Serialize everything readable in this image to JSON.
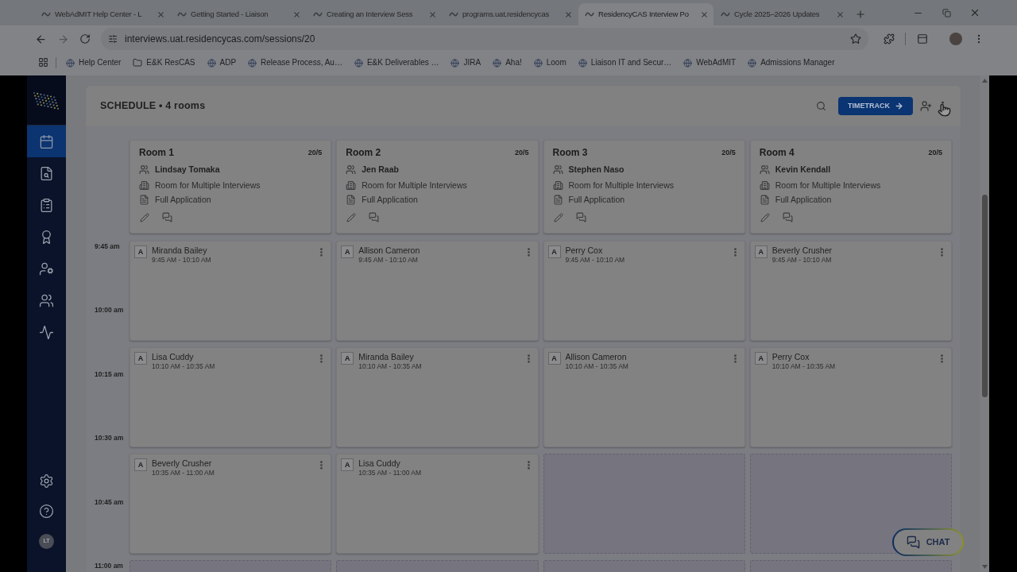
{
  "browser": {
    "tabs": [
      {
        "title": "WebAdMIT Help Center - L",
        "selected": false
      },
      {
        "title": "Getting Started - Liaison",
        "selected": false
      },
      {
        "title": "Creating an Interview Sess",
        "selected": false
      },
      {
        "title": "programs.uat.residencycas",
        "selected": false
      },
      {
        "title": "ResidencyCAS Interview Po",
        "selected": true
      },
      {
        "title": "Cycle 2025–2026 Updates",
        "selected": false
      }
    ],
    "url": "interviews.uat.residencycas.com/sessions/20",
    "bookmarks": [
      {
        "label": "Help Center",
        "kind": "link"
      },
      {
        "label": "E&K ResCAS",
        "kind": "folder"
      },
      {
        "label": "ADP",
        "kind": "link"
      },
      {
        "label": "Release Process, Au…",
        "kind": "link"
      },
      {
        "label": "E&K Deliverables …",
        "kind": "link"
      },
      {
        "label": "JIRA",
        "kind": "link"
      },
      {
        "label": "Aha!",
        "kind": "link"
      },
      {
        "label": "Loom",
        "kind": "link"
      },
      {
        "label": "Liaison IT and Secur…",
        "kind": "link"
      },
      {
        "label": "WebAdMIT",
        "kind": "link"
      },
      {
        "label": "Admissions Manager",
        "kind": "link"
      }
    ]
  },
  "sidebar": {
    "items": [
      {
        "selected": true
      },
      {
        "selected": false
      },
      {
        "selected": false
      },
      {
        "selected": false
      },
      {
        "selected": false
      },
      {
        "selected": false
      },
      {
        "selected": false
      }
    ],
    "avatar": "LT"
  },
  "schedule": {
    "title": "SCHEDULE • 4 rooms",
    "action_button": "TIMETRACK",
    "time_labels": [
      "9:45 am",
      "10:00 am",
      "10:15 am",
      "10:30 am",
      "10:45 am",
      "11:00 am"
    ],
    "rooms": [
      {
        "name": "Room 1",
        "capacity": "20/5",
        "interviewer": "Lindsay Tomaka",
        "room_type": "Room for Multiple Interviews",
        "application": "Full Application",
        "slots": [
          {
            "kind": "booked",
            "initial": "A",
            "name": "Miranda Bailey",
            "time": "9:45 AM - 10:10 AM"
          },
          {
            "kind": "booked",
            "initial": "A",
            "name": "Lisa Cuddy",
            "time": "10:10 AM - 10:35 AM"
          },
          {
            "kind": "booked",
            "initial": "A",
            "name": "Beverly Crusher",
            "time": "10:35 AM - 11:00 AM"
          },
          {
            "kind": "empty"
          }
        ]
      },
      {
        "name": "Room 2",
        "capacity": "20/5",
        "interviewer": "Jen Raab",
        "room_type": "Room for Multiple Interviews",
        "application": "Full Application",
        "slots": [
          {
            "kind": "booked",
            "initial": "A",
            "name": "Allison Cameron",
            "time": "9:45 AM - 10:10 AM"
          },
          {
            "kind": "booked",
            "initial": "A",
            "name": "Miranda Bailey",
            "time": "10:10 AM - 10:35 AM"
          },
          {
            "kind": "booked",
            "initial": "A",
            "name": "Lisa Cuddy",
            "time": "10:35 AM - 11:00 AM"
          },
          {
            "kind": "empty"
          }
        ]
      },
      {
        "name": "Room 3",
        "capacity": "20/5",
        "interviewer": "Stephen Naso",
        "room_type": "Room for Multiple Interviews",
        "application": "Full Application",
        "slots": [
          {
            "kind": "booked",
            "initial": "A",
            "name": "Perry Cox",
            "time": "9:45 AM - 10:10 AM"
          },
          {
            "kind": "booked",
            "initial": "A",
            "name": "Allison Cameron",
            "time": "10:10 AM - 10:35 AM"
          },
          {
            "kind": "empty"
          },
          {
            "kind": "empty"
          }
        ]
      },
      {
        "name": "Room 4",
        "capacity": "20/5",
        "interviewer": "Kevin Kendall",
        "room_type": "Room for Multiple Interviews",
        "application": "Full Application",
        "slots": [
          {
            "kind": "booked",
            "initial": "A",
            "name": "Beverly Crusher",
            "time": "9:45 AM - 10:10 AM"
          },
          {
            "kind": "booked",
            "initial": "A",
            "name": "Perry Cox",
            "time": "10:10 AM - 10:35 AM"
          },
          {
            "kind": "empty"
          },
          {
            "kind": "empty"
          }
        ]
      }
    ]
  },
  "chat": {
    "label": "CHAT"
  }
}
